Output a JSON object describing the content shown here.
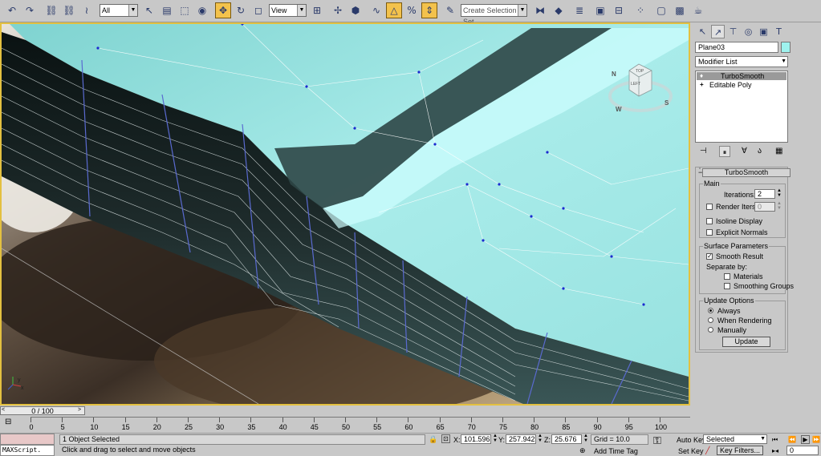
{
  "toolbar": {
    "selection_filter": "All",
    "reference_coord": "View",
    "named_selection_placeholder": "Create Selection Set"
  },
  "panel": {
    "object_name": "Plane03",
    "modifier_list": "Modifier List",
    "stack": [
      "TurboSmooth",
      "Editable Poly"
    ],
    "rollout_title": "TurboSmooth",
    "main_group": "Main",
    "iterations_label": "Iterations:",
    "iterations_value": "2",
    "render_iters_label": "Render Iters:",
    "render_iters_value": "0",
    "isoline_label": "Isoline Display",
    "explicit_normals_label": "Explicit Normals",
    "surface_group": "Surface Parameters",
    "smooth_result_label": "Smooth Result",
    "separate_by_label": "Separate by:",
    "materials_label": "Materials",
    "smoothing_groups_label": "Smoothing Groups",
    "update_group": "Update Options",
    "always_label": "Always",
    "when_rendering_label": "When Rendering",
    "manually_label": "Manually",
    "update_button": "Update"
  },
  "viewcube": {
    "top": "TOP",
    "left": "LEFT",
    "n": "N",
    "w": "W",
    "s": "S"
  },
  "timeline": {
    "frame_label": "0 / 100",
    "ticks": [
      "0",
      "5",
      "10",
      "15",
      "20",
      "25",
      "30",
      "35",
      "40",
      "45",
      "50",
      "55",
      "60",
      "65",
      "70",
      "75",
      "80",
      "85",
      "90",
      "95",
      "100"
    ]
  },
  "status": {
    "maxscript": "MAXScript.",
    "selected": "1 Object Selected",
    "prompt": "Click and drag to select and move objects",
    "x_label": "X:",
    "x_value": "101.596",
    "y_label": "Y:",
    "y_value": "257.942",
    "z_label": "Z:",
    "z_value": "25.676",
    "grid": "Grid = 10.0",
    "add_time_tag": "Add Time Tag",
    "auto_key": "Auto Key",
    "set_key": "Set Key",
    "key_mode": "Selected",
    "key_filters": "Key Filters...",
    "frame_value": "0"
  },
  "icons": [
    "undo-icon",
    "redo-icon",
    "link-icon",
    "unlink-icon",
    "bind-icon",
    "select-icon",
    "select-by-name-icon",
    "region-icon",
    "window-crossing-icon",
    "move-icon",
    "rotate-icon",
    "scale-icon",
    "pivot-icon",
    "snap-icon",
    "angle-snap-icon",
    "percent-snap-icon",
    "spinner-snap-icon",
    "mirror-icon",
    "align-icon",
    "layer-icon",
    "curve-editor-icon",
    "schematic-icon",
    "material-editor-icon",
    "render-setup-icon",
    "render-frame-icon",
    "render-icon"
  ]
}
